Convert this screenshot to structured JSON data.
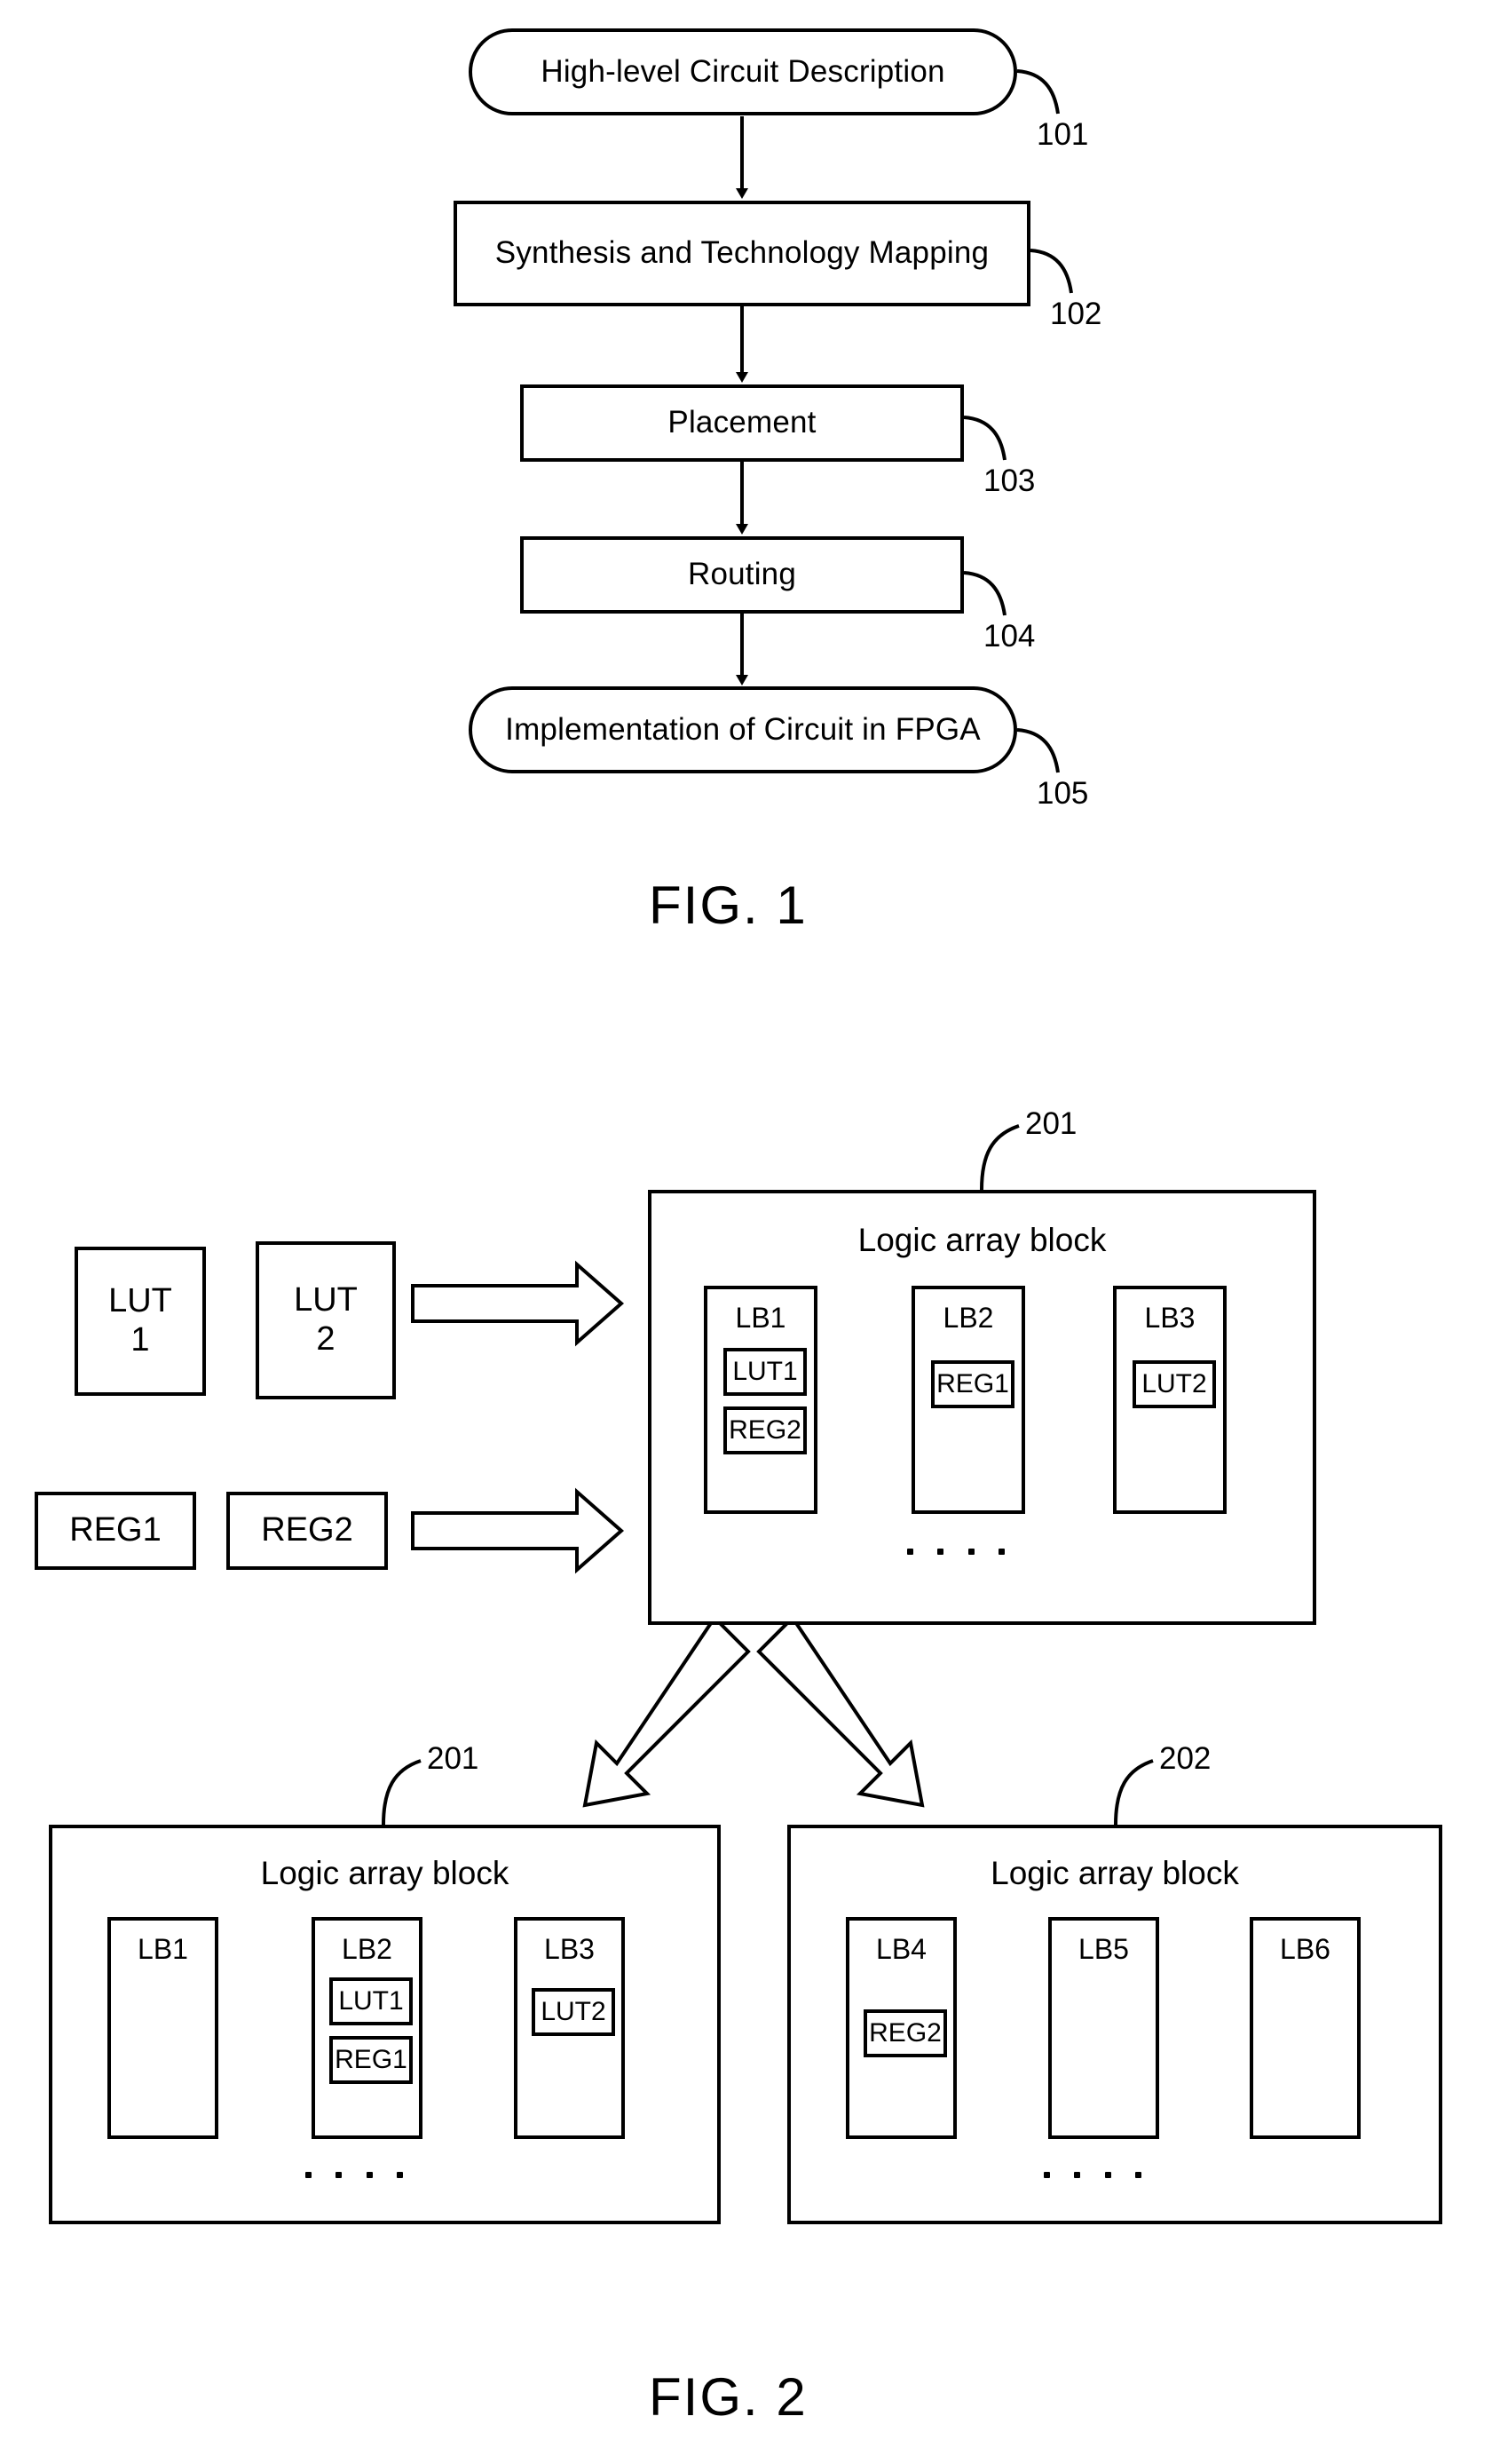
{
  "figure1": {
    "caption": "FIG. 1",
    "steps": [
      {
        "label": "High-level Circuit Description",
        "ref": "101",
        "shape": "rounded"
      },
      {
        "label": "Synthesis and Technology Mapping",
        "ref": "102",
        "shape": "rect"
      },
      {
        "label": "Placement",
        "ref": "103",
        "shape": "rect"
      },
      {
        "label": "Routing",
        "ref": "104",
        "shape": "rect"
      },
      {
        "label": "Implementation of Circuit in FPGA",
        "ref": "105",
        "shape": "rounded"
      }
    ]
  },
  "figure2": {
    "caption": "FIG. 2",
    "sources": {
      "luts": [
        {
          "line1": "LUT",
          "line2": "1"
        },
        {
          "line1": "LUT",
          "line2": "2"
        }
      ],
      "regs": [
        {
          "label": "REG1"
        },
        {
          "label": "REG2"
        }
      ]
    },
    "lab_top": {
      "ref": "201",
      "title": "Logic array block",
      "blocks": [
        {
          "name": "LB1",
          "cells": [
            "LUT1",
            "REG2"
          ]
        },
        {
          "name": "LB2",
          "cells": [
            "REG1"
          ]
        },
        {
          "name": "LB3",
          "cells": [
            "LUT2"
          ]
        }
      ],
      "ellipsis": ". . . ."
    },
    "lab_bottom_left": {
      "ref": "201",
      "title": "Logic array block",
      "blocks": [
        {
          "name": "LB1",
          "cells": []
        },
        {
          "name": "LB2",
          "cells": [
            "LUT1",
            "REG1"
          ]
        },
        {
          "name": "LB3",
          "cells": [
            "LUT2"
          ]
        }
      ],
      "ellipsis": ". . . ."
    },
    "lab_bottom_right": {
      "ref": "202",
      "title": "Logic array block",
      "blocks": [
        {
          "name": "LB4",
          "cells": [
            "REG2"
          ]
        },
        {
          "name": "LB5",
          "cells": []
        },
        {
          "name": "LB6",
          "cells": []
        }
      ],
      "ellipsis": ". . . ."
    }
  },
  "colors": {
    "ink": "#000000",
    "paper": "#ffffff"
  }
}
